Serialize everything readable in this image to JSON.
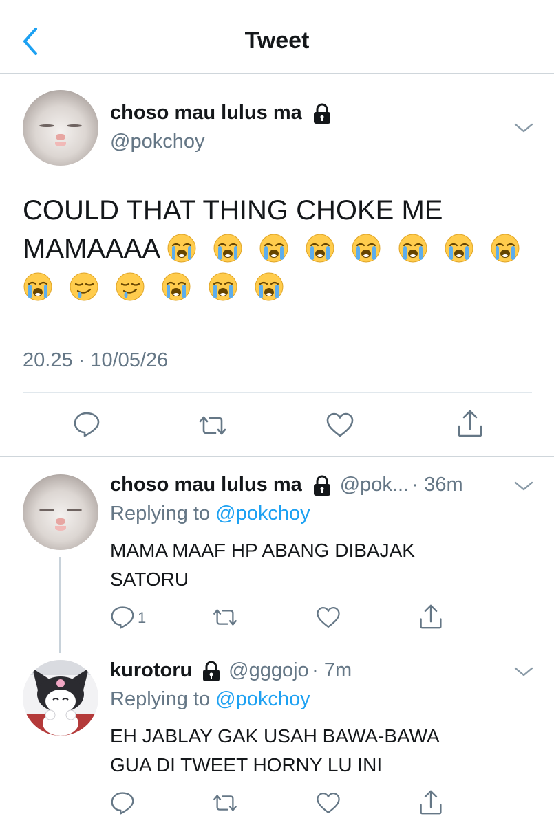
{
  "header": {
    "title": "Tweet"
  },
  "main_tweet": {
    "display_name": "choso mau lulus ma",
    "handle": "@pokchoy",
    "text": "COULD THAT THING CHOKE ME MAMAAAA",
    "emojis": [
      "loudly-crying-face",
      "loudly-crying-face",
      "loudly-crying-face",
      "loudly-crying-face",
      "loudly-crying-face",
      "loudly-crying-face",
      "loudly-crying-face",
      "loudly-crying-face",
      "loudly-crying-face",
      "drooling-face",
      "drooling-face",
      "loudly-crying-face",
      "loudly-crying-face",
      "loudly-crying-face"
    ],
    "timestamp": "20.25 · 10/05/26"
  },
  "replies": [
    {
      "display_name": "choso mau lulus ma",
      "handle": "@pok...",
      "time": "· 36m",
      "replying_prefix": "Replying to",
      "replying_handle": "@pokchoy",
      "text_line1": "MAMA MAAF HP ABANG DIBAJAK",
      "text_line2": "SATORU",
      "reply_count": "1"
    },
    {
      "display_name": "kurotoru",
      "handle": "@gggojo",
      "time": "· 7m",
      "replying_prefix": "Replying to",
      "replying_handle": "@pokchoy",
      "text_line1": "EH JABLAY GAK USAH BAWA-BAWA",
      "text_line2": "GUA DI TWEET HORNY LU INI"
    }
  ],
  "colors": {
    "accent": "#1da1f2",
    "secondary_text": "#657786",
    "primary_text": "#14171a",
    "divider": "#e1e8ed"
  }
}
